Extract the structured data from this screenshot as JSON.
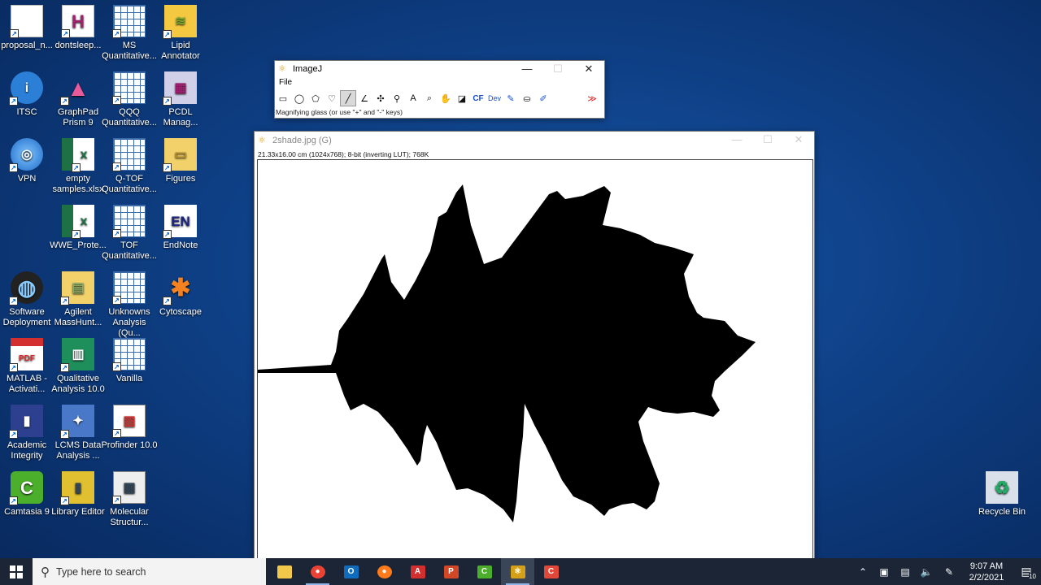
{
  "desktop_icons": [
    {
      "label": "proposal_n...",
      "icon": "document-icon"
    },
    {
      "label": "dontsleep...",
      "icon": "h-app-icon"
    },
    {
      "label": "MS Quantitative...",
      "icon": "grid-app-icon"
    },
    {
      "label": "Lipid Annotator",
      "icon": "lipid-icon"
    },
    {
      "label": "ITSC",
      "icon": "info-icon"
    },
    {
      "label": "GraphPad Prism 9",
      "icon": "prism-icon"
    },
    {
      "label": "QQQ Quantitative...",
      "icon": "grid-app-icon"
    },
    {
      "label": "PCDL Manag...",
      "icon": "pcdl-icon"
    },
    {
      "label": "VPN",
      "icon": "globe-icon"
    },
    {
      "label": "empty samples.xlsx",
      "icon": "excel-icon"
    },
    {
      "label": "Q-TOF Quantitative...",
      "icon": "grid-app-icon"
    },
    {
      "label": "Figures",
      "icon": "folder-icon"
    },
    {
      "label": "WWE_Prote...",
      "icon": "excel-icon"
    },
    {
      "label": "TOF Quantitative...",
      "icon": "grid-app-icon"
    },
    {
      "label": "EndNote",
      "icon": "endnote-icon"
    },
    {
      "label": "Software Deployment",
      "icon": "deploy-icon"
    },
    {
      "label": "Agilent MassHunt...",
      "icon": "folder-zip-icon"
    },
    {
      "label": "Unknowns Analysis (Qu...",
      "icon": "unknowns-icon"
    },
    {
      "label": "Cytoscape",
      "icon": "cytoscape-icon"
    },
    {
      "label": "MATLAB - Activati...",
      "icon": "pdf-icon"
    },
    {
      "label": "Qualitative Analysis 10.0",
      "icon": "qual-icon"
    },
    {
      "label": "Vanilla",
      "icon": "grid-app-icon"
    },
    {
      "label": "Academic Integrity",
      "icon": "book-icon"
    },
    {
      "label": "LCMS Data Analysis ...",
      "icon": "lcms-icon"
    },
    {
      "label": "Profinder 10.0",
      "icon": "profinder-icon"
    },
    {
      "label": "Camtasia 9",
      "icon": "camtasia-icon"
    },
    {
      "label": "Library Editor",
      "icon": "library-icon"
    },
    {
      "label": "Molecular Structur...",
      "icon": "molecular-icon"
    },
    {
      "label": "Recycle Bin",
      "icon": "recycle-bin-icon"
    }
  ],
  "imagej": {
    "title": "ImageJ",
    "menu_file": "File",
    "status": "Magnifying glass (or use \"+\" and \"-\" keys)",
    "tools": [
      "rectangle-tool-icon",
      "oval-tool-icon",
      "polygon-tool-icon",
      "freehand-tool-icon",
      "line-tool-icon",
      "angle-tool-icon",
      "point-tool-icon",
      "wand-tool-icon",
      "text-tool-icon",
      "magnifier-tool-icon",
      "hand-tool-icon",
      "color-picker-tool-icon",
      "cf-tool-icon",
      "dev-tool-icon",
      "brush-tool-icon",
      "flood-fill-tool-icon",
      "pipette-tool-icon",
      "blank-tool-icon",
      "blank-tool-icon",
      "more-tools-icon"
    ],
    "tool_cf": "CF",
    "tool_dev": "Dev"
  },
  "image_window": {
    "title": "2shade.jpg (G)",
    "info": "21.33x16.00 cm (1024x768); 8-bit (inverting LUT); 768K"
  },
  "taskbar": {
    "search_placeholder": "Type here to search",
    "time": "9:07 AM",
    "date": "2/2/2021",
    "notification_count": "10",
    "apps": [
      "file-explorer-icon",
      "chrome-icon",
      "outlook-icon",
      "firefox-icon",
      "acrobat-icon",
      "powerpoint-icon",
      "camtasia-icon",
      "imagej-icon",
      "camtasia-recorder-icon"
    ]
  }
}
